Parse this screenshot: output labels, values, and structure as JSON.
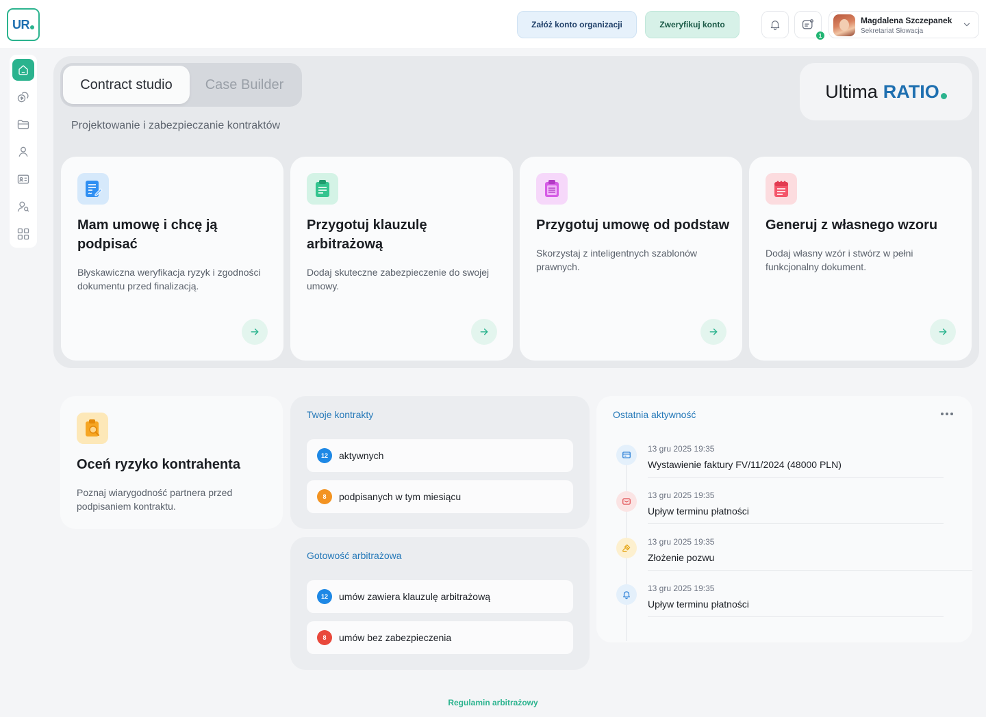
{
  "header": {
    "logo_text": "UR",
    "create_org_label": "Załóż konto organizacji",
    "verify_label": "Zweryfikuj konto",
    "messages_badge": "1",
    "user": {
      "name": "Magdalena Szczepanek",
      "role": "Sekretariat Słowacja"
    }
  },
  "sidebar": {
    "items": [
      {
        "icon": "home-icon",
        "active": true
      },
      {
        "icon": "coins-icon",
        "active": false
      },
      {
        "icon": "folder-icon",
        "active": false
      },
      {
        "icon": "user-icon",
        "active": false
      },
      {
        "icon": "id-card-icon",
        "active": false
      },
      {
        "icon": "user-search-icon",
        "active": false
      },
      {
        "icon": "grid-icon",
        "active": false
      }
    ]
  },
  "studio": {
    "tabs": [
      {
        "label": "Contract studio",
        "active": true
      },
      {
        "label": "Case Builder",
        "active": false
      }
    ],
    "subtitle": "Projektowanie i zabezpieczanie kontraktów",
    "brand": {
      "text_a": "Ultima",
      "text_b": "RATIO"
    },
    "cards": [
      {
        "title": "Mam umowę i chcę ją podpisać",
        "desc": "Błyskawiczna weryfikacja ryzyk i zgodności dokumentu przed finalizacją.",
        "icon": "document-sign-icon"
      },
      {
        "title": "Przygotuj klauzulę arbitrażową",
        "desc": "Dodaj skuteczne zabezpieczenie do swojej umowy.",
        "icon": "clipboard-clause-icon"
      },
      {
        "title": "Przygotuj umowę od podstaw",
        "desc": "Skorzystaj z inteligentnych szablonów prawnych.",
        "icon": "clipboard-list-icon"
      },
      {
        "title": "Generuj z własnego wzoru",
        "desc": "Dodaj własny wzór i stwórz w pełni funkcjonalny dokument.",
        "icon": "notepad-icon"
      }
    ]
  },
  "risk_card": {
    "title": "Oceń ryzyko kontrahenta",
    "desc": "Poznaj wiarygodność partnera przed podpisaniem kontraktu.",
    "icon": "clipboard-search-icon"
  },
  "contracts": {
    "title": "Twoje kontrakty",
    "rows": [
      {
        "count": "12",
        "label": "aktywnych",
        "color": "#1e88e5"
      },
      {
        "count": "8",
        "label": "podpisanych w tym miesiącu",
        "color": "#f39322"
      }
    ]
  },
  "arbitration": {
    "title": "Gotowość arbitrażowa",
    "rows": [
      {
        "count": "12",
        "label": "umów zawiera klauzulę arbitrażową",
        "color": "#1e88e5"
      },
      {
        "count": "8",
        "label": "umów bez zabezpieczenia",
        "color": "#e9483b"
      }
    ]
  },
  "activity": {
    "title": "Ostatnia aktywność",
    "items": [
      {
        "time": "13 gru 2025  19:35",
        "text": "Wystawienie faktury FV/11/2024 (48000 PLN)",
        "icon": "invoice-icon"
      },
      {
        "time": "13 gru 2025  19:35",
        "text": "Upływ terminu płatności",
        "icon": "mail-icon"
      },
      {
        "time": "13 gru 2025  19:35",
        "text": "Złożenie pozwu",
        "icon": "gavel-icon"
      },
      {
        "time": "13 gru 2025  19:35",
        "text": "Upływ terminu płatności",
        "icon": "bell-icon"
      }
    ]
  },
  "footer": {
    "link": "Regulamin arbitrażowy"
  }
}
